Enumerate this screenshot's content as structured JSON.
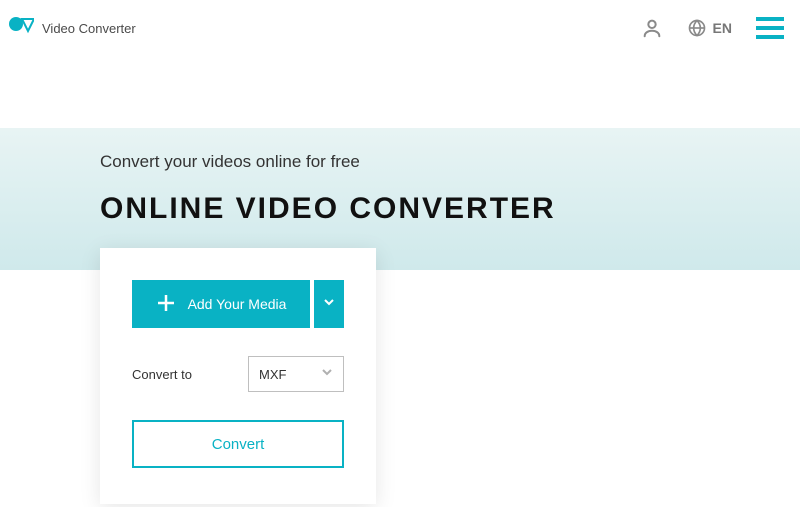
{
  "header": {
    "brand_name": "Video Converter",
    "language_label": "EN"
  },
  "hero": {
    "subtitle": "Convert your videos online for free",
    "title": "ONLINE VIDEO CONVERTER"
  },
  "panel": {
    "add_media_label": "Add Your Media",
    "convert_to_label": "Convert to",
    "format_selected": "MXF",
    "convert_button_label": "Convert"
  }
}
